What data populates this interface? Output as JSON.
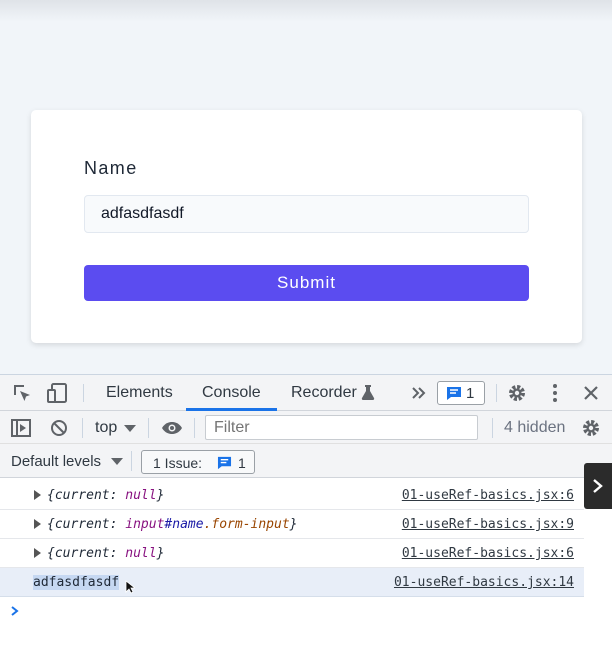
{
  "form": {
    "label": "Name",
    "input_value": "adfasdfasdf",
    "submit_label": "Submit",
    "accent_color": "#5b4cf0"
  },
  "devtools": {
    "tabs": [
      {
        "label": "Elements"
      },
      {
        "label": "Console"
      },
      {
        "label": "Recorder"
      }
    ],
    "active_tab": "Console",
    "issues_count": "1",
    "toolbar": {
      "context": "top",
      "filter_placeholder": "Filter",
      "hidden_label": "4 hidden"
    },
    "levels_label": "Default levels",
    "issue_chip": {
      "text": "1 Issue:",
      "count": "1"
    },
    "icons": [
      "inspect-icon",
      "device-toolbar-icon",
      "flask-icon",
      "more-tabs-icon",
      "message-icon",
      "settings-icon",
      "kebab-icon",
      "close-icon",
      "sidebar-icon",
      "clear-icon",
      "eye-icon",
      "chevron-right-icon"
    ],
    "logs": [
      {
        "open": "{",
        "key": "current",
        "sep": ": ",
        "val": "null",
        "close": "}",
        "source": "01-useRef-basics.jsx:6"
      },
      {
        "open": "{",
        "key": "current",
        "sep": ": ",
        "tag": "input",
        "id": "#name",
        "cls": ".form-input",
        "close": "}",
        "source": "01-useRef-basics.jsx:9"
      },
      {
        "open": "{",
        "key": "current",
        "sep": ": ",
        "val": "null",
        "close": "}",
        "source": "01-useRef-basics.jsx:6"
      },
      {
        "text": "adfasdfasdf",
        "source": "01-useRef-basics.jsx:14"
      }
    ]
  }
}
